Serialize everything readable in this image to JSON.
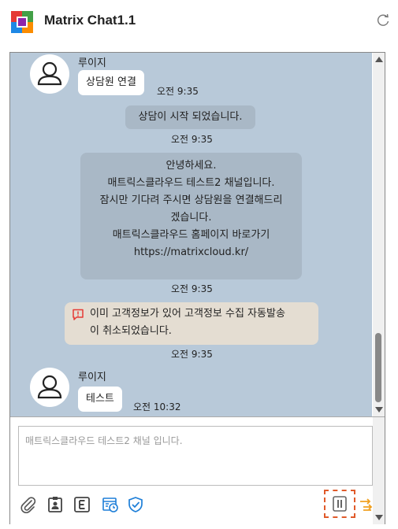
{
  "app": {
    "title": "Matrix Chat1.1"
  },
  "messages": {
    "first": {
      "sender": "루이지",
      "text": "상담원 연결",
      "time": "오전 9:35"
    },
    "system_start": {
      "text": "상담이 시작 되었습니다.",
      "time": "오전 9:35"
    },
    "welcome": {
      "lines": [
        "안녕하세요.",
        "매트릭스클라우드 테스트2 채널입니다.",
        "잠시만 기다려 주시면 상담원을 연결해드리",
        "겠습니다.",
        "매트릭스클라우드 홈페이지 바로가기",
        "https://matrixcloud.kr/"
      ],
      "time": "오전 9:35"
    },
    "warning": {
      "lines": [
        "이미 고객정보가 있어 고객정보 수집 자동발송",
        "이 취소되었습니다."
      ],
      "time": "오전 9:35"
    },
    "last": {
      "sender": "루이지",
      "text": "테스트",
      "time": "오전 10:32"
    }
  },
  "composer": {
    "placeholder": "매트릭스클라우드 테스트2 채널 입니다."
  },
  "colors": {
    "chat_bg": "#b8c9d9",
    "system_bubble": "#a9b8c6",
    "warning_bubble": "#e4ddd2",
    "accent_blue": "#1e7fd8",
    "accent_orange": "#f0a020",
    "pause_border": "#e05a2a"
  },
  "icons": {
    "toolbar": [
      "paperclip-icon",
      "clipboard-user-icon",
      "letter-e-icon",
      "calendar-clock-icon",
      "shield-check-icon",
      "pause-icon",
      "transfer-icon"
    ]
  }
}
